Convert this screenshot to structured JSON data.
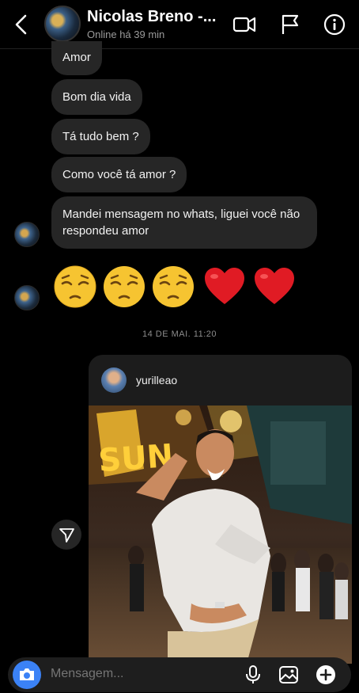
{
  "header": {
    "title": "Nicolas Breno -...",
    "status": "Online há 39 min"
  },
  "messages": [
    {
      "text": "Amor"
    },
    {
      "text": "Bom dia vida"
    },
    {
      "text": "Tá tudo bem ?"
    },
    {
      "text": "Como você tá amor ?"
    },
    {
      "text": "Mandei mensagem no whats, liguei você não respondeu amor"
    }
  ],
  "emoji_message": [
    "pensive-face",
    "pensive-face",
    "pensive-face",
    "red-heart",
    "red-heart"
  ],
  "timestamp": "14 DE MAI. 11:20",
  "shared_post": {
    "username": "yurilleao",
    "sign_text": "SUN"
  },
  "composer": {
    "placeholder": "Mensagem..."
  },
  "colors": {
    "background": "#000000",
    "bubble": "#262626",
    "accent": "#3b82f6"
  }
}
